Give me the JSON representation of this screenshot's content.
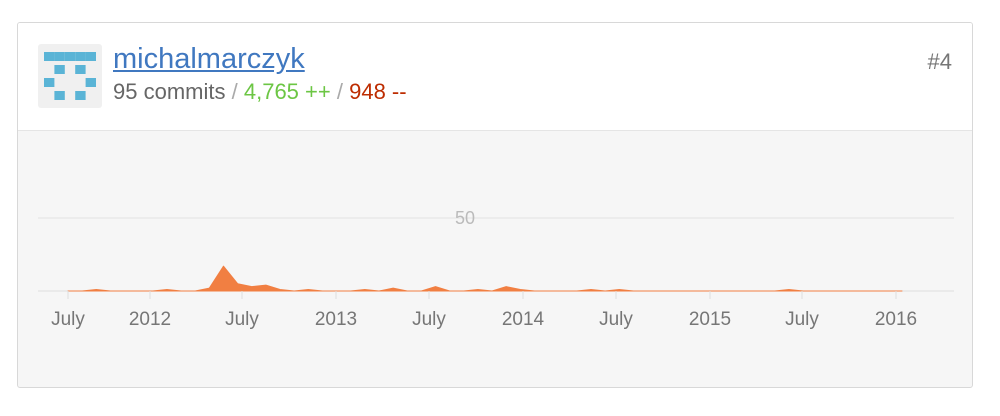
{
  "contributor": {
    "username": "michalmarczyk",
    "commits_text": "95 commits",
    "separator": "/",
    "additions_text": "4,765 ++",
    "deletions_text": "948 --",
    "rank": "#4",
    "avatar_icon": "identicon-avatar"
  },
  "colors": {
    "link": "#4078c0",
    "additions": "#6cc644",
    "deletions": "#bd2c00",
    "area": "#f17f42",
    "identicon": "#5ab4d6"
  },
  "chart_data": {
    "type": "area",
    "title": "",
    "xlabel": "",
    "ylabel": "",
    "ylim": [
      0,
      75
    ],
    "yticks": [
      {
        "value": 50,
        "label": "50"
      }
    ],
    "grid": true,
    "x_tick_labels": [
      "July",
      "2012",
      "July",
      "2013",
      "July",
      "2014",
      "July",
      "2015",
      "July",
      "2016"
    ],
    "x": [
      "2011-06",
      "2011-07",
      "2011-08",
      "2011-09",
      "2011-10",
      "2011-11",
      "2011-12",
      "2012-01",
      "2012-02",
      "2012-03",
      "2012-04",
      "2012-05",
      "2012-06",
      "2012-07",
      "2012-08",
      "2012-09",
      "2012-10",
      "2012-11",
      "2012-12",
      "2013-01",
      "2013-02",
      "2013-03",
      "2013-04",
      "2013-05",
      "2013-06",
      "2013-07",
      "2013-08",
      "2013-09",
      "2013-10",
      "2013-11",
      "2013-12",
      "2014-01",
      "2014-02",
      "2014-03",
      "2014-04",
      "2014-05",
      "2014-06",
      "2014-07",
      "2014-08",
      "2014-09",
      "2014-10",
      "2014-11",
      "2014-12",
      "2015-01",
      "2015-02",
      "2015-03",
      "2015-04",
      "2015-05",
      "2015-06",
      "2015-07",
      "2015-08",
      "2015-09",
      "2015-10",
      "2015-11",
      "2015-12",
      "2016-01",
      "2016-02",
      "2016-03",
      "2016-04",
      "2016-05"
    ],
    "series": [
      {
        "values": [
          0,
          0,
          1,
          0,
          0,
          0,
          0,
          1,
          0,
          0,
          2,
          17,
          5,
          3,
          4,
          1,
          0,
          1,
          0,
          0,
          0,
          1,
          0,
          2,
          0,
          0,
          3,
          0,
          0,
          1,
          0,
          3,
          1,
          0,
          0,
          0,
          0,
          1,
          0,
          1,
          0,
          0,
          0,
          0,
          0,
          0,
          0,
          0,
          0,
          0,
          0,
          1,
          0,
          0,
          0,
          0,
          0,
          0,
          0,
          0
        ]
      }
    ]
  }
}
